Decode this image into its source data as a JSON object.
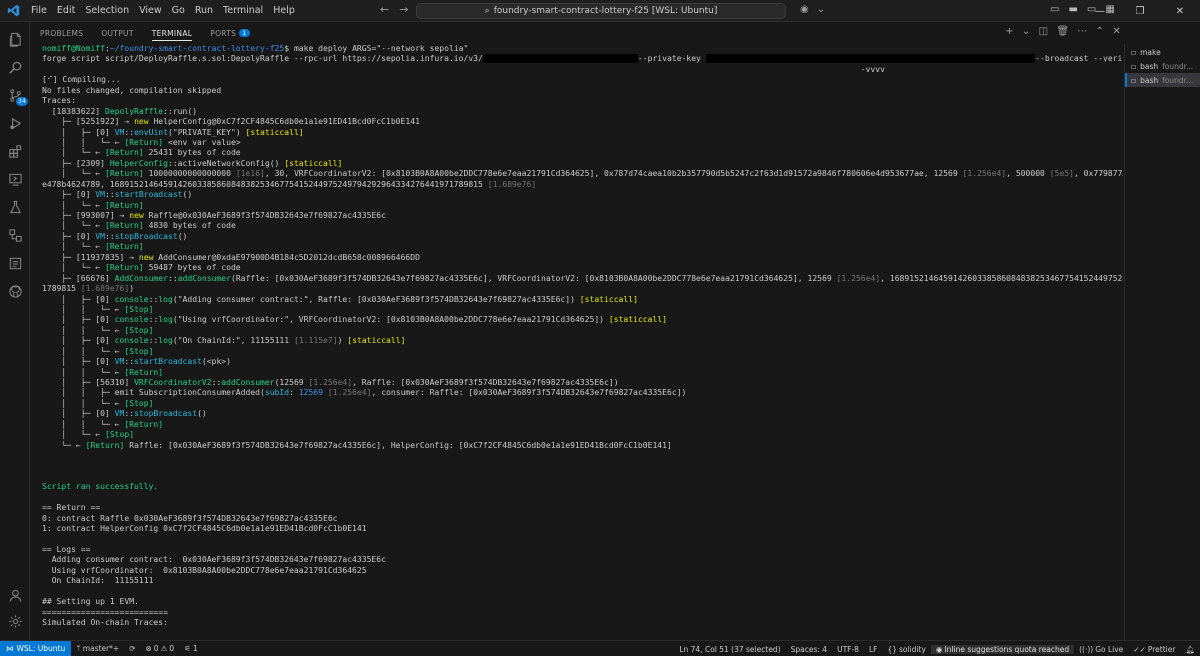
{
  "titlebar": {
    "menu": [
      "File",
      "Edit",
      "Selection",
      "View",
      "Go",
      "Run",
      "Terminal",
      "Help"
    ],
    "search_text": "foundry-smart-contract-lottery-f25 [WSL: Ubuntu]"
  },
  "panel": {
    "tabs": [
      "PROBLEMS",
      "OUTPUT",
      "TERMINAL",
      "PORTS"
    ],
    "ports_count": "1"
  },
  "activity_badge": "34",
  "terminals": [
    {
      "name": "make",
      "detail": ""
    },
    {
      "name": "bash",
      "detail": "foundr..."
    },
    {
      "name": "bash",
      "detail": "foundr..."
    }
  ],
  "terminal_lines": [
    [
      [
        "g",
        "nomiff@Nomiff"
      ],
      [
        "u",
        ":"
      ],
      [
        "b",
        "~/foundry-smart-contract-lottery-f25"
      ],
      [
        "u",
        "$ make deploy ARGS=\"--network sepolia\""
      ]
    ],
    [
      [
        "u",
        "forge script script/DeployRaffle.s.sol:DepolyRaffle --rpc-url https://sepolia.infura.io/v3/"
      ],
      [
        "x",
        "                                "
      ],
      [
        "u",
        "--private-key "
      ],
      [
        "x",
        "                                                                    "
      ],
      [
        "u",
        "--broadcast --verify --etherscan-api-key "
      ],
      [
        "x",
        "                  "
      ]
    ],
    [
      [
        "u",
        "                                                                                                                                                                         -vvvv"
      ]
    ],
    [
      [
        "u",
        "[⠊] Compiling..."
      ]
    ],
    [
      [
        "u",
        "No files changed, compilation skipped"
      ]
    ],
    [
      [
        "u",
        "Traces:"
      ]
    ],
    [
      [
        "u",
        "  [18383622] "
      ],
      [
        "g",
        "DepolyRaffle"
      ],
      [
        "u",
        "::run()"
      ]
    ],
    [
      [
        "u",
        "    ├─ [5251922] → "
      ],
      [
        "y",
        "new"
      ],
      [
        "u",
        " HelperConfig@0xC7f2CF4845C6db0e1a1e91ED41Bcd0FcC1b0E141"
      ]
    ],
    [
      [
        "u",
        "    │   ├─ [0] "
      ],
      [
        "c",
        "VM"
      ],
      [
        "u",
        "::"
      ],
      [
        "c",
        "envUint"
      ],
      [
        "u",
        "(\"PRIVATE_KEY\") "
      ],
      [
        "y",
        "[staticcall]"
      ]
    ],
    [
      [
        "u",
        "    │   │   └─ ← "
      ],
      [
        "g",
        "[Return]"
      ],
      [
        "u",
        " <env var value>"
      ]
    ],
    [
      [
        "u",
        "    │   └─ ← "
      ],
      [
        "g",
        "[Return]"
      ],
      [
        "u",
        " 25431 bytes of code"
      ]
    ],
    [
      [
        "u",
        "    ├─ [2309] "
      ],
      [
        "g",
        "HelperConfig"
      ],
      [
        "u",
        "::activeNetworkConfig() "
      ],
      [
        "y",
        "[staticcall]"
      ]
    ],
    [
      [
        "u",
        "    │   └─ ← "
      ],
      [
        "g",
        "[Return]"
      ],
      [
        "u",
        " 10000000000000000 "
      ],
      [
        "d",
        "[1e16]"
      ],
      [
        "u",
        ", 30, VRFCoordinatorV2: [0x8103B0A8A00be2DDC778e6e7eaa21791Cd364625], 0x787d74caea10b2b357790d5b5247c2f63d1d91572a9846f780606e4d953677ae, 12569 "
      ],
      [
        "d",
        "[1.256e4]"
      ],
      [
        "u",
        ", 500000 "
      ],
      [
        "d",
        "[5e5]"
      ],
      [
        "u",
        ", 0x779877A7B0D9E8603169DdbD7836"
      ]
    ],
    [
      [
        "u",
        "e478b4624789, 16891521464591426033858608483825346775415244975249794292964334276441971789815 "
      ],
      [
        "d",
        "[1.689e76]"
      ]
    ],
    [
      [
        "u",
        "    ├─ [0] "
      ],
      [
        "c",
        "VM"
      ],
      [
        "u",
        "::"
      ],
      [
        "c",
        "startBroadcast"
      ],
      [
        "u",
        "()"
      ]
    ],
    [
      [
        "u",
        "    │   └─ ← "
      ],
      [
        "g",
        "[Return]"
      ]
    ],
    [
      [
        "u",
        "    ├─ [993007] → "
      ],
      [
        "y",
        "new"
      ],
      [
        "u",
        " Raffle@0x030AeF3689f3f574DB32643e7f69827ac4335E6c"
      ]
    ],
    [
      [
        "u",
        "    │   └─ ← "
      ],
      [
        "g",
        "[Return]"
      ],
      [
        "u",
        " 4830 bytes of code"
      ]
    ],
    [
      [
        "u",
        "    ├─ [0] "
      ],
      [
        "c",
        "VM"
      ],
      [
        "u",
        "::"
      ],
      [
        "c",
        "stopBroadcast"
      ],
      [
        "u",
        "()"
      ]
    ],
    [
      [
        "u",
        "    │   └─ ← "
      ],
      [
        "g",
        "[Return]"
      ]
    ],
    [
      [
        "u",
        "    ├─ [11937835] → "
      ],
      [
        "y",
        "new"
      ],
      [
        "u",
        " AddConsumer@0xdaE97900D4B184c5D2012dcdB658c008966466DD"
      ]
    ],
    [
      [
        "u",
        "    │   └─ ← "
      ],
      [
        "g",
        "[Return]"
      ],
      [
        "u",
        " 59487 bytes of code"
      ]
    ],
    [
      [
        "u",
        "    ├─ [66676] "
      ],
      [
        "g",
        "AddConsumer"
      ],
      [
        "u",
        "::"
      ],
      [
        "g",
        "addConsumer"
      ],
      [
        "u",
        "(Raffle: [0x030AeF3689f3f574DB32643e7f69827ac4335E6c], VRFCoordinatorV2: [0x8103B0A8A00be2DDC778e6e7eaa21791Cd364625], 12569 "
      ],
      [
        "d",
        "[1.256e4]"
      ],
      [
        "u",
        ", 16891521464591426033858608483825346775415244975249794292964334276441971"
      ]
    ],
    [
      [
        "u",
        "1789815 "
      ],
      [
        "d",
        "[1.689e76]"
      ],
      [
        "u",
        ")"
      ]
    ],
    [
      [
        "u",
        "    │   ├─ [0] "
      ],
      [
        "g",
        "console"
      ],
      [
        "u",
        "::"
      ],
      [
        "g",
        "log"
      ],
      [
        "u",
        "(\"Adding consumer contract:\", Raffle: [0x030AeF3689f3f574DB32643e7f69827ac4335E6c]) "
      ],
      [
        "y",
        "[staticcall]"
      ]
    ],
    [
      [
        "u",
        "    │   │   └─ ← "
      ],
      [
        "g",
        "[Stop]"
      ]
    ],
    [
      [
        "u",
        "    │   ├─ [0] "
      ],
      [
        "g",
        "console"
      ],
      [
        "u",
        "::"
      ],
      [
        "g",
        "log"
      ],
      [
        "u",
        "(\"Using vrfCoordinator:\", VRFCoordinatorV2: [0x8103B0A8A00be2DDC778e6e7eaa21791Cd364625]) "
      ],
      [
        "y",
        "[staticcall]"
      ]
    ],
    [
      [
        "u",
        "    │   │   └─ ← "
      ],
      [
        "g",
        "[Stop]"
      ]
    ],
    [
      [
        "u",
        "    │   ├─ [0] "
      ],
      [
        "g",
        "console"
      ],
      [
        "u",
        "::"
      ],
      [
        "g",
        "log"
      ],
      [
        "u",
        "(\"On ChainId:\", 11155111 "
      ],
      [
        "d",
        "[1.115e7]"
      ],
      [
        "u",
        ") "
      ],
      [
        "y",
        "[staticcall]"
      ]
    ],
    [
      [
        "u",
        "    │   │   └─ ← "
      ],
      [
        "g",
        "[Stop]"
      ]
    ],
    [
      [
        "u",
        "    │   ├─ [0] "
      ],
      [
        "c",
        "VM"
      ],
      [
        "u",
        "::"
      ],
      [
        "c",
        "startBroadcast"
      ],
      [
        "u",
        "(<pk>)"
      ]
    ],
    [
      [
        "u",
        "    │   │   └─ ← "
      ],
      [
        "g",
        "[Return]"
      ]
    ],
    [
      [
        "u",
        "    │   ├─ [56310] "
      ],
      [
        "g",
        "VRFCoordinatorV2"
      ],
      [
        "u",
        "::"
      ],
      [
        "g",
        "addConsumer"
      ],
      [
        "u",
        "(12569 "
      ],
      [
        "d",
        "[1.256e4]"
      ],
      [
        "u",
        ", Raffle: [0x030AeF3689f3f574DB32643e7f69827ac4335E6c])"
      ]
    ],
    [
      [
        "u",
        "    │   │   ├─ emit SubscriptionConsumerAdded("
      ],
      [
        "c",
        "subId"
      ],
      [
        "u",
        ": "
      ],
      [
        "b",
        "12569"
      ],
      [
        "u",
        " "
      ],
      [
        "d",
        "[1.256e4]"
      ],
      [
        "u",
        ", consumer: Raffle: [0x030AeF3689f3f574DB32643e7f69827ac4335E6c])"
      ]
    ],
    [
      [
        "u",
        "    │   │   └─ ← "
      ],
      [
        "g",
        "[Stop]"
      ]
    ],
    [
      [
        "u",
        "    │   ├─ [0] "
      ],
      [
        "c",
        "VM"
      ],
      [
        "u",
        "::"
      ],
      [
        "c",
        "stopBroadcast"
      ],
      [
        "u",
        "()"
      ]
    ],
    [
      [
        "u",
        "    │   │   └─ ← "
      ],
      [
        "g",
        "[Return]"
      ]
    ],
    [
      [
        "u",
        "    │   └─ ← "
      ],
      [
        "g",
        "[Stop]"
      ]
    ],
    [
      [
        "u",
        "    └─ ← "
      ],
      [
        "g",
        "[Return]"
      ],
      [
        "u",
        " Raffle: [0x030AeF3689f3f574DB32643e7f69827ac4335E6c], HelperConfig: [0xC7f2CF4845C6db0e1a1e91ED41Bcd0FcC1b0E141]"
      ]
    ],
    [
      [
        "u",
        ""
      ]
    ],
    [
      [
        "u",
        ""
      ]
    ],
    [
      [
        "u",
        ""
      ]
    ],
    [
      [
        "g",
        "Script ran successfully."
      ]
    ],
    [
      [
        "u",
        ""
      ]
    ],
    [
      [
        "u",
        "== Return =="
      ]
    ],
    [
      [
        "u",
        "0: contract Raffle 0x030AeF3689f3f574DB32643e7f69827ac4335E6c"
      ]
    ],
    [
      [
        "u",
        "1: contract HelperConfig 0xC7f2CF4845C6db0e1a1e91ED41Bcd0FcC1b0E141"
      ]
    ],
    [
      [
        "u",
        ""
      ]
    ],
    [
      [
        "u",
        "== Logs =="
      ]
    ],
    [
      [
        "u",
        "  Adding consumer contract:  0x030AeF3689f3f574DB32643e7f69827ac4335E6c"
      ]
    ],
    [
      [
        "u",
        "  Using vrfCoordinator:  0x8103B0A8A00be2DDC778e6e7eaa21791Cd364625"
      ]
    ],
    [
      [
        "u",
        "  On ChainId:  11155111"
      ]
    ],
    [
      [
        "u",
        ""
      ]
    ],
    [
      [
        "u",
        "## Setting up 1 EVM."
      ]
    ],
    [
      [
        "u",
        "=========================="
      ]
    ],
    [
      [
        "u",
        "Simulated On-chain Traces:"
      ]
    ]
  ],
  "statusbar": {
    "remote": "WSL: Ubuntu",
    "branch": "master*+",
    "errors": "0",
    "warnings": "0",
    "ports": "1",
    "position": "Ln 74, Col 51 (37 selected)",
    "spaces": "Spaces: 4",
    "encoding": "UTF-8",
    "eol": "LF",
    "language": "solidity",
    "quota": "Inline suggestions quota reached",
    "golive": "Go Live",
    "prettier": "Prettier"
  },
  "colors": {
    "accent": "#0078d4",
    "green": "#23d18b",
    "yellow": "#e5e510",
    "blue": "#3b8eea",
    "cyan": "#29b8db"
  }
}
